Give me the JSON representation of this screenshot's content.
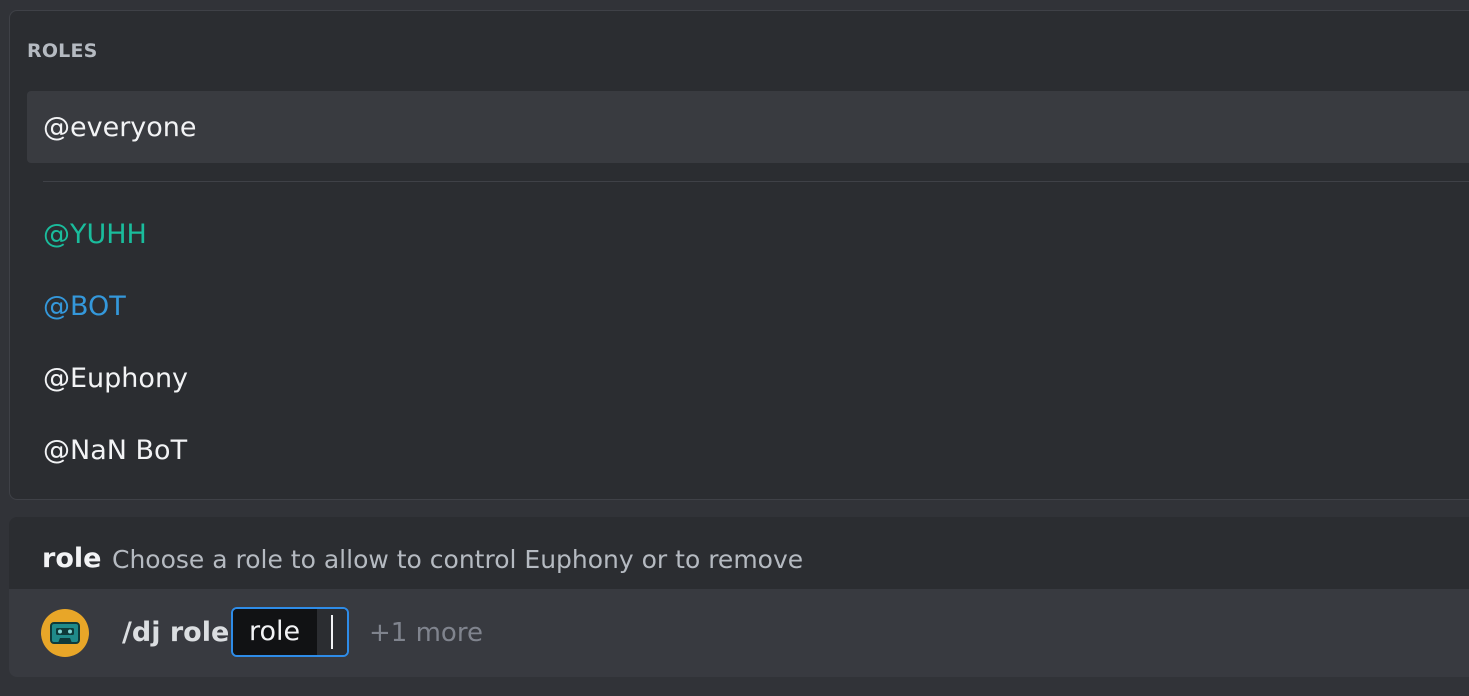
{
  "autocomplete": {
    "section_title": "ROLES",
    "selected_role": "@everyone",
    "roles": [
      {
        "label": "@YUHH",
        "color": "#1abc9c"
      },
      {
        "label": "@BOT",
        "color": "#3498db"
      },
      {
        "label": "@Euphony",
        "color": "#f2f3f5"
      },
      {
        "label": "@NaN BoT",
        "color": "#f2f3f5"
      }
    ]
  },
  "option_hint": {
    "name": "role",
    "description": "Choose a role to allow to control Euphony or to remove"
  },
  "command_bar": {
    "bot_avatar_icon": "cassette-tape-icon",
    "command": "/dj role",
    "option_label": "role",
    "more_options": "+1 more"
  },
  "colors": {
    "accent_focus": "#2e8ce8",
    "avatar_bg": "#e8a628"
  }
}
